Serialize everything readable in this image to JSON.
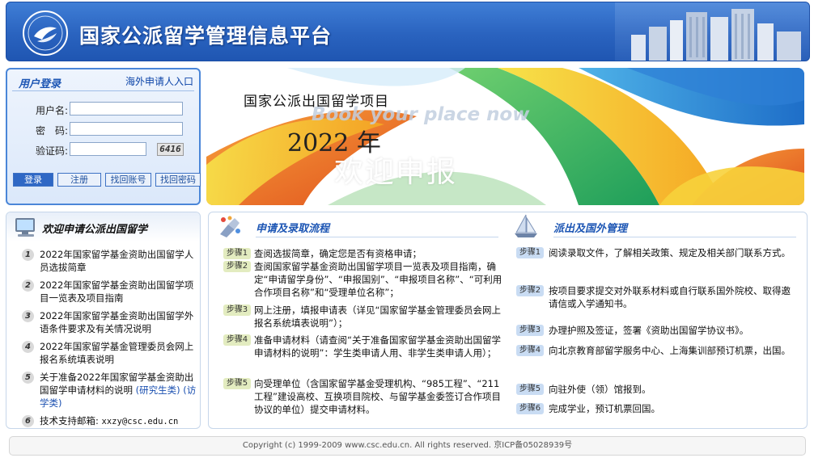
{
  "header": {
    "title": "国家公派留学管理信息平台"
  },
  "login": {
    "title": "用户登录",
    "overseas_link": "海外申请人入口",
    "username_label": "用户名:",
    "password_label": "密　码:",
    "captcha_label": "验证码:",
    "username_value": "",
    "password_value": "",
    "captcha_value": "",
    "captcha_code": "6416",
    "buttons": {
      "login": "登录",
      "register": "注册",
      "recover_account": "找回账号",
      "recover_password": "找回密码"
    }
  },
  "banner": {
    "line1": "国家公派出国留学项目",
    "slogan": "Book your place now",
    "year": "2022 年",
    "welcome": "欢迎申报"
  },
  "left_panel": {
    "title": "欢迎申请公派出国留学",
    "items": [
      {
        "num": "1",
        "text": "2022年国家留学基金资助出国留学人员选拔简章"
      },
      {
        "num": "2",
        "text": "2022年国家留学基金资助出国留学项目一览表及项目指南"
      },
      {
        "num": "3",
        "text": "2022年国家留学基金资助出国留学外语条件要求及有关情况说明"
      },
      {
        "num": "4",
        "text": "2022年国家留学基金管理委员会网上报名系统填表说明"
      },
      {
        "num": "5",
        "text": "关于准备2022年国家留学基金资助出国留学申请材料的说明",
        "link1": "(研究生类)",
        "link2": "(访学类)"
      },
      {
        "num": "6",
        "text": "技术支持邮箱:",
        "email": "xxzy@csc.edu.cn"
      }
    ]
  },
  "process": {
    "title": "申请及录取流程",
    "steps": [
      {
        "badge": "步骤1",
        "text": "查阅选拔简章，确定您是否有资格申请；"
      },
      {
        "badge": "步骤2",
        "text": "查阅国家留学基金资助出国留学项目一览表及项目指南，确定“申请留学身份”、“申报国别”、“申报项目名称”、“可利用合作项目名称”和“受理单位名称”；"
      },
      {
        "badge": "步骤3",
        "text": "网上注册，填报申请表（详见“国家留学基金管理委员会网上报名系统填表说明”）；"
      },
      {
        "badge": "步骤4",
        "text": "准备申请材料（请查阅“关于准备国家留学基金资助出国留学申请材料的说明”：学生类申请人用、非学生类申请人用）；"
      },
      {
        "badge": "步骤5",
        "text": "向受理单位（含国家留学基金受理机构、“985工程”、“211工程”建设高校、互换项目院校、与留学基金委签订合作项目协议的单位）提交申请材料。"
      }
    ]
  },
  "abroad": {
    "title": "派出及国外管理",
    "steps": [
      {
        "badge": "步骤1",
        "text": "阅读录取文件，了解相关政策、规定及相关部门联系方式。"
      },
      {
        "badge": "步骤2",
        "text": "按项目要求提交对外联系材料或自行联系国外院校、取得邀请信或入学通知书。"
      },
      {
        "badge": "步骤3",
        "text": "办理护照及签证，签署《资助出国留学协议书》。"
      },
      {
        "badge": "步骤4",
        "text": "向北京教育部留学服务中心、上海集训部预订机票，出国。"
      },
      {
        "badge": "步骤5",
        "text": "向驻外使（领）馆报到。"
      },
      {
        "badge": "步骤6",
        "text": "完成学业，预订机票回国。"
      }
    ]
  },
  "footer": {
    "text": "Copyright (c) 1999-2009 www.csc.edu.cn.  All rights reserved.   京ICP备05028939号"
  }
}
